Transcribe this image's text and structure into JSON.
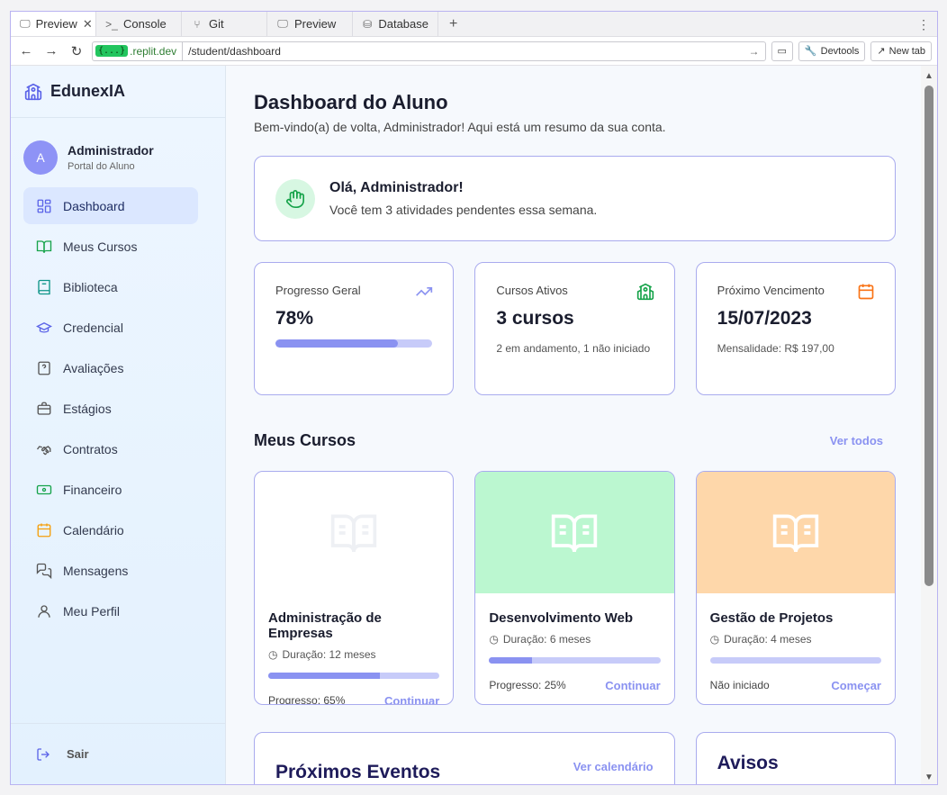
{
  "browser": {
    "tabs": [
      {
        "label": "Preview",
        "icon": "monitor-icon"
      },
      {
        "label": "Console",
        "icon": "terminal-icon"
      },
      {
        "label": "Git",
        "icon": "git-icon"
      },
      {
        "label": "Preview",
        "icon": "monitor-icon"
      },
      {
        "label": "Database",
        "icon": "database-icon"
      }
    ],
    "url_domain": ".replit.dev",
    "url_badge": "{...}",
    "url_path": "/student/dashboard",
    "devtools_label": "Devtools",
    "newtab_label": "New tab"
  },
  "sidebar": {
    "brand": "EdunexIA",
    "user": {
      "initial": "A",
      "name": "Administrador",
      "role": "Portal do Aluno"
    },
    "items": [
      {
        "label": "Dashboard",
        "icon": "dashboard-icon",
        "active": true
      },
      {
        "label": "Meus Cursos",
        "icon": "book-open-icon"
      },
      {
        "label": "Biblioteca",
        "icon": "book-icon"
      },
      {
        "label": "Credencial",
        "icon": "graduation-cap-icon"
      },
      {
        "label": "Avaliações",
        "icon": "question-icon"
      },
      {
        "label": "Estágios",
        "icon": "briefcase-icon"
      },
      {
        "label": "Contratos",
        "icon": "handshake-icon"
      },
      {
        "label": "Financeiro",
        "icon": "banknote-icon"
      },
      {
        "label": "Calendário",
        "icon": "calendar-icon"
      },
      {
        "label": "Mensagens",
        "icon": "messages-icon"
      },
      {
        "label": "Meu Perfil",
        "icon": "user-icon"
      }
    ],
    "logout": "Sair"
  },
  "main": {
    "title": "Dashboard do Aluno",
    "subtitle": "Bem-vindo(a) de volta, Administrador! Aqui está um resumo da sua conta.",
    "welcome": {
      "title": "Olá, Administrador!",
      "text": "Você tem 3 atividades pendentes essa semana."
    },
    "stats": {
      "progress": {
        "label": "Progresso Geral",
        "value": "78%",
        "fraction": 0.78
      },
      "active": {
        "label": "Cursos Ativos",
        "value": "3 cursos",
        "note": "2 em andamento, 1 não iniciado"
      },
      "due": {
        "label": "Próximo Vencimento",
        "value": "15/07/2023",
        "note": "Mensalidade: R$ 197,00"
      }
    },
    "courses_section": {
      "title": "Meus Cursos",
      "link": "Ver todos"
    },
    "courses": [
      {
        "title": "Administração de Empresas",
        "duration": "Duração: 12 meses",
        "status": "Progresso: 65%",
        "action": "Continuar",
        "progress": 0.65,
        "color": "#ffffff"
      },
      {
        "title": "Desenvolvimento Web",
        "duration": "Duração: 6 meses",
        "status": "Progresso: 25%",
        "action": "Continuar",
        "progress": 0.25,
        "color": "#bbf7d0"
      },
      {
        "title": "Gestão de Projetos",
        "duration": "Duração: 4 meses",
        "status": "Não iniciado",
        "action": "Começar",
        "progress": 0,
        "color": "#fed7aa"
      }
    ],
    "events": {
      "title": "Próximos Eventos",
      "link": "Ver calendário"
    },
    "notices": {
      "title": "Avisos"
    }
  },
  "colors": {
    "accent": "#8a92f1",
    "border": "#a9abee",
    "green": "#16a34a",
    "orange": "#f97316"
  }
}
